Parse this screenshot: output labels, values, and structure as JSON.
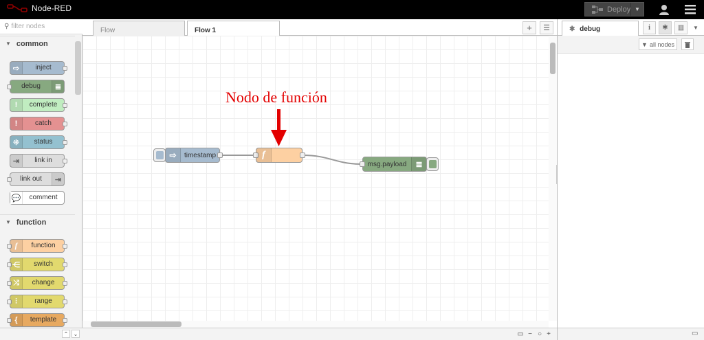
{
  "header": {
    "app_title": "Node-RED",
    "deploy_label": "Deploy",
    "colors": {
      "bar": "#000000",
      "deploy_bg": "#444444"
    }
  },
  "palette": {
    "filter_placeholder": "filter nodes",
    "categories": [
      {
        "label": "common",
        "nodes": [
          {
            "label": "inject",
            "color": "#a6bbcf",
            "icon": "arrow-right-icon"
          },
          {
            "label": "debug",
            "color": "#87a980",
            "icon": "list-icon"
          },
          {
            "label": "complete",
            "color": "#c0edc0",
            "icon": "exclamation-icon"
          },
          {
            "label": "catch",
            "color": "#e49191",
            "icon": "exclamation-icon"
          },
          {
            "label": "status",
            "color": "#94c1d0",
            "icon": "pulse-icon"
          },
          {
            "label": "link in",
            "color": "#dddddd",
            "icon": "link-arrow-icon"
          },
          {
            "label": "link out",
            "color": "#dddddd",
            "icon": "link-arrow-icon"
          },
          {
            "label": "comment",
            "color": "#ffffff",
            "icon": "speech-bubble-icon"
          }
        ]
      },
      {
        "label": "function",
        "nodes": [
          {
            "label": "function",
            "color": "#fdd0a2",
            "icon": "function-icon"
          },
          {
            "label": "switch",
            "color": "#e2d96e",
            "icon": "switch-icon"
          },
          {
            "label": "change",
            "color": "#e2d96e",
            "icon": "shuffle-icon"
          },
          {
            "label": "range",
            "color": "#e2d96e",
            "icon": "range-icon"
          },
          {
            "label": "template",
            "color": "#e7a960",
            "icon": "curly-brace-icon"
          }
        ]
      }
    ]
  },
  "workspace": {
    "tabs": [
      {
        "label": "Flow",
        "active": false
      },
      {
        "label": "Flow 1",
        "active": true
      }
    ],
    "flow_nodes": {
      "inject": {
        "label": "timestamp",
        "color": "#a6bbcf"
      },
      "function": {
        "label": "",
        "color": "#fdd0a2"
      },
      "debug": {
        "label": "msg.payload",
        "color": "#87a980"
      }
    },
    "annotation": "Nodo de función",
    "annotation_color": "#e30000"
  },
  "sidebar": {
    "active_tab": "debug",
    "filter_button": "all nodes"
  }
}
